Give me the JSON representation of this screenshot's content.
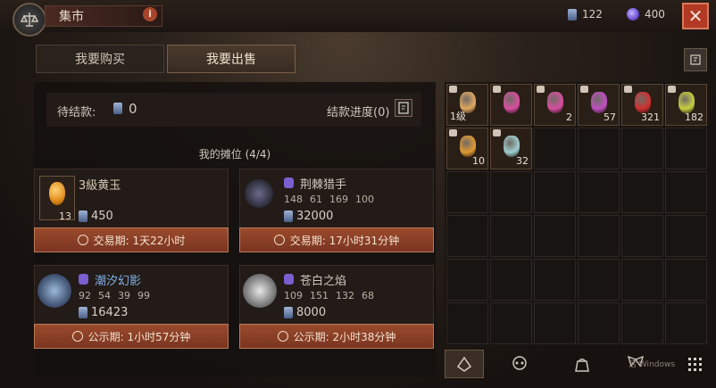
{
  "header": {
    "title": "集市",
    "info_label": "i",
    "currency": [
      {
        "icon": "gem-currency-icon",
        "value": "122"
      },
      {
        "icon": "orb-currency-icon",
        "value": "400"
      }
    ],
    "close_label": "✕"
  },
  "tabs": [
    {
      "label": "我要购买",
      "active": false
    },
    {
      "label": "我要出售",
      "active": true
    }
  ],
  "pending": {
    "label": "待结款:",
    "value": "0",
    "progress_label": "结款进度(0)"
  },
  "stalls": {
    "title": "我的摊位 (4/4)",
    "cards": [
      {
        "name": "3級黄玉",
        "qty": "13",
        "price": "450",
        "stats": [],
        "timer": "交易期: 1天22小时",
        "name_color": "#d6c8b2"
      },
      {
        "name": "荆棘猎手",
        "qty": "",
        "price": "32000",
        "stats": [
          "148",
          "61",
          "169",
          "100"
        ],
        "timer": "交易期: 17小时31分钟",
        "name_color": "#d6c8b2"
      },
      {
        "name": "潮汐幻影",
        "qty": "",
        "price": "16423",
        "stats": [
          "92",
          "54",
          "39",
          "99"
        ],
        "timer": "公示期: 1小时57分钟",
        "name_color": "#7fb0e6"
      },
      {
        "name": "苍白之焰",
        "qty": "",
        "price": "8000",
        "stats": [
          "109",
          "151",
          "132",
          "68"
        ],
        "timer": "公示期: 2小时38分钟",
        "name_color": "#d6c8b2"
      }
    ]
  },
  "inventory": [
    {
      "label": "1级",
      "count": "",
      "color": "#e0a860"
    },
    {
      "label": "",
      "count": "",
      "color": "#d84fa0"
    },
    {
      "label": "",
      "count": "2",
      "color": "#d84fa0"
    },
    {
      "label": "",
      "count": "57",
      "color": "#c04fc0"
    },
    {
      "label": "",
      "count": "321",
      "color": "#d03030"
    },
    {
      "label": "",
      "count": "182",
      "color": "#c8d040"
    },
    {
      "label": "",
      "count": "10",
      "color": "#e09a30"
    },
    {
      "label": "",
      "count": "32",
      "color": "#9ed0d0"
    }
  ],
  "watermark": "活 Windows"
}
